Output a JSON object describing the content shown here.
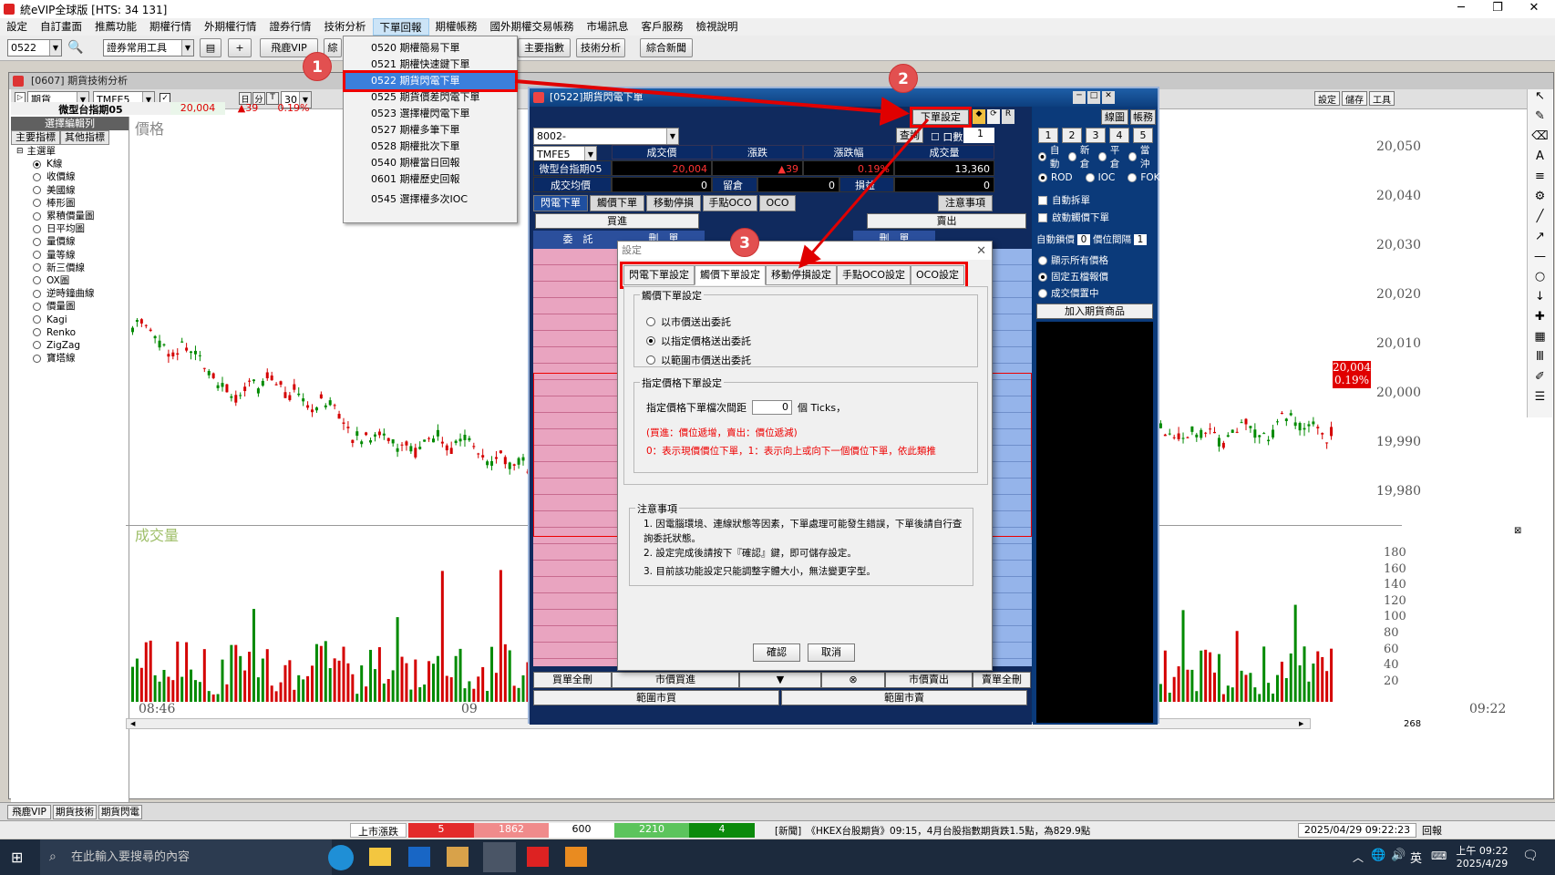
{
  "window": {
    "title": "統eVIP全球版  [HTS: 34 131]"
  },
  "menubar": [
    "設定",
    "自訂畫面",
    "推薦功能",
    "期權行情",
    "外期權行情",
    "證券行情",
    "技術分析",
    "下單回報",
    "期權帳務",
    "國外期權交易帳務",
    "市場訊息",
    "客戶服務",
    "檢視說明"
  ],
  "menubar_active_index": 7,
  "toolbar": {
    "symbol_value": "0522",
    "securities_combo": "證券常用工具",
    "feihu_vip": "飛鹿VIP",
    "comprehensive_btn": "綜",
    "main_index": "主要指數",
    "tech_analysis": "技術分析",
    "news": "綜合新聞"
  },
  "dropdown_menu": [
    "0520 期權簡易下單",
    "0521 期權快速鍵下單",
    "0522 期貨閃電下單",
    "0525 期貨價差閃電下單",
    "0523 選擇權閃電下單",
    "0527 期權多筆下單",
    "0528 期權批次下單",
    "0540 期權當日回報",
    "0601 期權歷史回報",
    "0545 選擇權多次IOC"
  ],
  "dropdown_selected_index": 2,
  "chart_window": {
    "title": "[0607] 期貨技術分析",
    "market_combo": "期貨",
    "symbol_combo": "TMFE5",
    "period_combo": "30",
    "product_name": "微型台指期05",
    "last_price": "20,004",
    "change": "▲39",
    "change_pct": "0.19%",
    "left_panel": {
      "section": "選擇編輯列",
      "tab_main": "主要指標",
      "tab_other": "其他指標",
      "tree_root": "主選單",
      "items": [
        "K線",
        "收價線",
        "美國線",
        "棒形圖",
        "累積價量圖",
        "日平均圖",
        "量價線",
        "量等線",
        "新三價線",
        "OX圖",
        "逆時鐘曲線",
        "價量圖",
        "Kagi",
        "Renko",
        "ZigZag",
        "寶塔線"
      ],
      "selected_index": 0
    },
    "price_label": "價格",
    "volume_label": "成交量",
    "y_ticks": [
      "20,050",
      "20,040",
      "20,030",
      "20,020",
      "20,010",
      "20,000",
      "19,990",
      "19,980"
    ],
    "vol_ticks": [
      "180",
      "160",
      "140",
      "120",
      "100",
      "80",
      "60",
      "40",
      "20"
    ],
    "x_ticks": [
      "08:46",
      "09",
      "09:22"
    ],
    "current_tag_price": "20,004",
    "current_tag_pct": "0.19%",
    "right_tools": {
      "settings": "設定",
      "save": "儲存",
      "tools": "工具"
    },
    "scroll_count": "268",
    "colors": {
      "up": "#d40000",
      "down": "#008a00",
      "bg": "#ffffff",
      "tag": "#e00000"
    }
  },
  "order_window": {
    "title": "[0522]期貨閃電下單",
    "order_settings_btn": "下單設定",
    "account": "8002-",
    "query_btn": "查詢",
    "qty_label": "口數",
    "qty_value": "1",
    "symbol": "TMFE5",
    "headers": [
      "成交價",
      "漲跌",
      "漲跌幅",
      "成交量"
    ],
    "name": "微型台指期05",
    "last": "20,004",
    "chg": "▲39",
    "chg_pct": "0.19%",
    "volume": "13,360",
    "avg_label": "成交均價",
    "avg_value": "0",
    "position_label": "留倉",
    "position_value": "0",
    "pnl_label": "損益",
    "pnl_value": "0",
    "tabs": [
      "閃電下單",
      "觸價下單",
      "移動停損",
      "手點OCO",
      "OCO"
    ],
    "notes_btn": "注意事項",
    "buy_label": "買進",
    "sell_label": "賣出",
    "delete_label": "刪　單",
    "entrust_label": "委　託",
    "bottom_buttons": [
      "買單全刪",
      "市價買進",
      "▼",
      "⊗",
      "市價賣出",
      "賣單全刪"
    ],
    "range_buy": "範圍市買",
    "range_sell": "範圍市賣",
    "right_panel": {
      "line_chart": "線圖",
      "account": "帳務",
      "qty_buttons": [
        "1",
        "2",
        "3",
        "4",
        "5"
      ],
      "order_types": [
        "自動",
        "新倉",
        "平倉",
        "當沖"
      ],
      "time_in_force": [
        "ROD",
        "IOC",
        "FOK"
      ],
      "auto_split": "自動拆單",
      "trigger_order": "啟動觸價下單",
      "auto_stop": "自動鎖價",
      "auto_stop_val": "0",
      "price_gap": "價位間隔",
      "price_gap_val": "1",
      "show_all": "顯示所有價格",
      "fixed_five": "固定五檔報價",
      "trade_center": "成交價置中",
      "add_product": "加入期貨商品"
    }
  },
  "dialog": {
    "title": "設定",
    "tabs": [
      "閃電下單設定",
      "觸價下單設定",
      "移動停損設定",
      "手點OCO設定",
      "OCO設定"
    ],
    "active_tab": 1,
    "group1_title": "觸價下單設定",
    "options": [
      "以市價送出委託",
      "以指定價格送出委託",
      "以範圍市價送出委託"
    ],
    "selected_option": 1,
    "group2_title": "指定價格下單設定",
    "tick_label": "指定價格下單檔次間距",
    "tick_value": "0",
    "tick_unit": "個 Ticks，",
    "red_note1": "(買進：價位遞增，賣出：價位遞減)",
    "red_note2": "0：表示現價價位下單，1：表示向上或向下一個價位下單，依此類推",
    "notes_title": "注意事項",
    "notes": [
      "1. 因電腦環境、連線狀態等因素，下單處理可能發生錯誤，下單後請自行查詢委託狀態。",
      "2. 設定完成後請按下『確認』鍵，即可儲存設定。",
      "3. 目前該功能設定只能調整字體大小，無法變更字型。"
    ],
    "ok": "確認",
    "cancel": "取消"
  },
  "annotations": {
    "one": "1",
    "two": "2",
    "three": "3",
    "color": "#e00000"
  },
  "bottom_tabs": [
    "飛鹿VIP",
    "期貨技術",
    "期貨閃電"
  ],
  "statusbar": {
    "market_label": "上市漲跌",
    "v1": "5",
    "v2": "1862",
    "v3": "600",
    "v4": "2210",
    "v5": "4",
    "news": "[新聞]　《HKEX台股期貨》09:15，4月台股指數期貨跌1.5點，為829.9點",
    "datetime": "2025/04/29 09:22:23",
    "report": "回報"
  },
  "taskbar": {
    "search_placeholder": "在此輸入要搜尋的內容",
    "ime": "英",
    "time": "上午 09:22",
    "date": "2025/4/29"
  }
}
